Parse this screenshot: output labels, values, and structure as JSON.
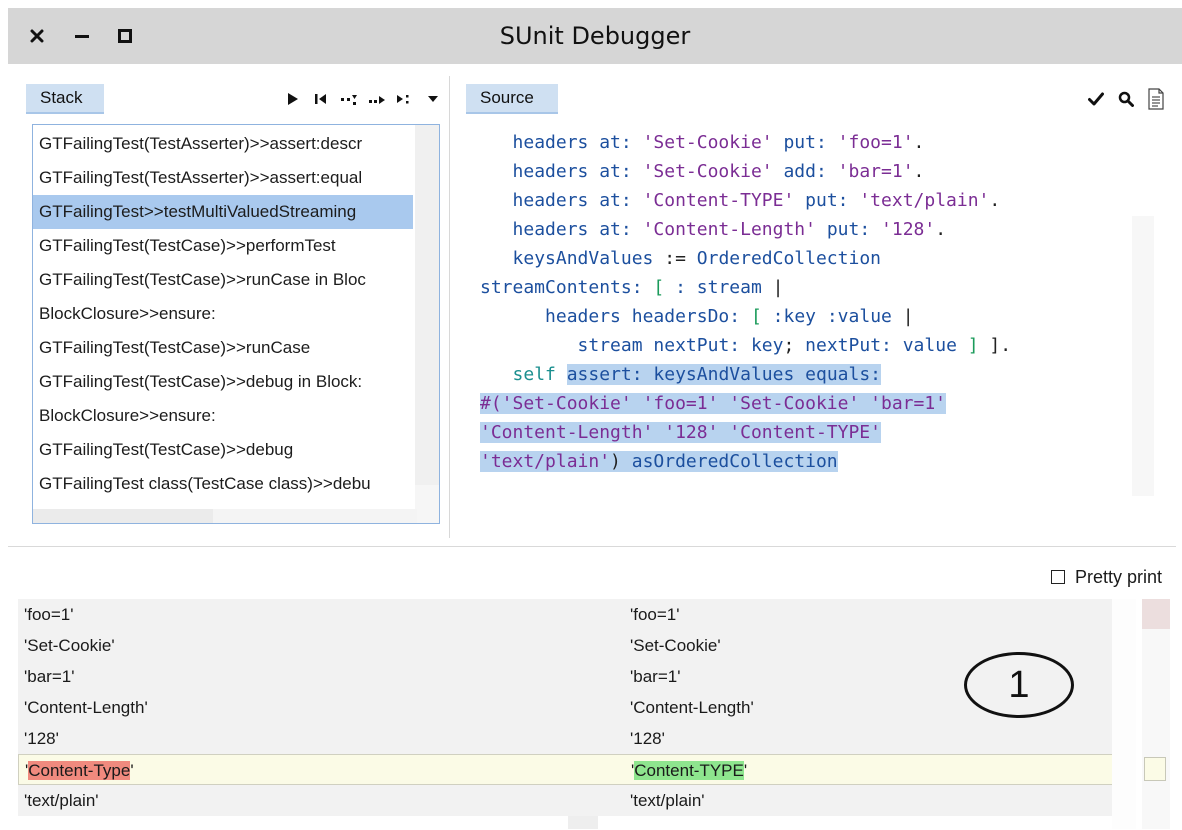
{
  "window": {
    "title": "SUnit Debugger",
    "controls": [
      "close",
      "minimize",
      "maximize"
    ]
  },
  "stack": {
    "tab_label": "Stack",
    "toolbar_icons": [
      "play-icon",
      "restart-icon",
      "step-into-icon",
      "step-over-icon",
      "step-through-icon",
      "dropdown-icon"
    ],
    "items": [
      "GTFailingTest(TestAsserter)>>assert:descr",
      "GTFailingTest(TestAsserter)>>assert:equal",
      "GTFailingTest>>testMultiValuedStreaming",
      "GTFailingTest(TestCase)>>performTest",
      "GTFailingTest(TestCase)>>runCase in Bloc",
      "BlockClosure>>ensure:",
      "GTFailingTest(TestCase)>>runCase",
      "GTFailingTest(TestCase)>>debug in Block:",
      "BlockClosure>>ensure:",
      "GTFailingTest(TestCase)>>debug",
      "GTFailingTest class(TestCase class)>>debu"
    ],
    "selected_index": 2
  },
  "source": {
    "tab_label": "Source",
    "toolbar_icons": [
      "accept-check-icon",
      "search-icon",
      "document-icon"
    ],
    "lines": [
      {
        "indent": "   ",
        "tokens": [
          [
            "k",
            "headers"
          ],
          [
            "plain",
            " "
          ],
          [
            "k",
            "at:"
          ],
          [
            "plain",
            " "
          ],
          [
            "str",
            "'Set-Cookie'"
          ],
          [
            "plain",
            " "
          ],
          [
            "k",
            "put:"
          ],
          [
            "plain",
            " "
          ],
          [
            "str",
            "'foo=1'"
          ],
          [
            "plain",
            "."
          ]
        ]
      },
      {
        "indent": "   ",
        "tokens": [
          [
            "k",
            "headers"
          ],
          [
            "plain",
            " "
          ],
          [
            "k",
            "at:"
          ],
          [
            "plain",
            " "
          ],
          [
            "str",
            "'Set-Cookie'"
          ],
          [
            "plain",
            " "
          ],
          [
            "k",
            "add:"
          ],
          [
            "plain",
            " "
          ],
          [
            "str",
            "'bar=1'"
          ],
          [
            "plain",
            "."
          ]
        ]
      },
      {
        "indent": "   ",
        "tokens": [
          [
            "k",
            "headers"
          ],
          [
            "plain",
            " "
          ],
          [
            "k",
            "at:"
          ],
          [
            "plain",
            " "
          ],
          [
            "str",
            "'Content-TYPE'"
          ],
          [
            "plain",
            " "
          ],
          [
            "k",
            "put:"
          ],
          [
            "plain",
            " "
          ],
          [
            "str",
            "'text/plain'"
          ],
          [
            "plain",
            "."
          ]
        ]
      },
      {
        "indent": "   ",
        "tokens": [
          [
            "k",
            "headers"
          ],
          [
            "plain",
            " "
          ],
          [
            "k",
            "at:"
          ],
          [
            "plain",
            " "
          ],
          [
            "str",
            "'Content-Length'"
          ],
          [
            "plain",
            " "
          ],
          [
            "k",
            "put:"
          ],
          [
            "plain",
            " "
          ],
          [
            "str",
            "'128'"
          ],
          [
            "plain",
            "."
          ]
        ]
      },
      {
        "indent": "   ",
        "tokens": [
          [
            "k",
            "keysAndValues"
          ],
          [
            "plain",
            " := "
          ],
          [
            "k",
            "OrderedCollection"
          ]
        ]
      },
      {
        "indent": "",
        "tokens": [
          [
            "k",
            "streamContents:"
          ],
          [
            "plain",
            " "
          ],
          [
            "br",
            "["
          ],
          [
            "plain",
            " "
          ],
          [
            "k",
            ": stream"
          ],
          [
            "plain",
            " |"
          ]
        ]
      },
      {
        "indent": "      ",
        "tokens": [
          [
            "k",
            "headers"
          ],
          [
            "plain",
            " "
          ],
          [
            "k",
            "headersDo:"
          ],
          [
            "plain",
            " "
          ],
          [
            "br",
            "["
          ],
          [
            "plain",
            " "
          ],
          [
            "k",
            ":key"
          ],
          [
            "plain",
            " "
          ],
          [
            "k",
            ":value"
          ],
          [
            "plain",
            " |"
          ]
        ]
      },
      {
        "indent": "         ",
        "tokens": [
          [
            "k",
            "stream"
          ],
          [
            "plain",
            " "
          ],
          [
            "k",
            "nextPut:"
          ],
          [
            "plain",
            " "
          ],
          [
            "k",
            "key"
          ],
          [
            "plain",
            "; "
          ],
          [
            "k",
            "nextPut:"
          ],
          [
            "plain",
            " "
          ],
          [
            "k",
            "value"
          ],
          [
            "plain",
            " "
          ],
          [
            "br",
            "]"
          ],
          [
            "plain",
            " ]."
          ]
        ]
      },
      {
        "indent": "   ",
        "tokens": [
          [
            "self",
            "self"
          ],
          [
            "plain",
            " "
          ],
          [
            "hlk",
            "assert:"
          ],
          [
            "hlp",
            " "
          ],
          [
            "hlk",
            "keysAndValues"
          ],
          [
            "hlp",
            " "
          ],
          [
            "hlk",
            "equals:"
          ]
        ]
      },
      {
        "indent": "",
        "tokens": [
          [
            "hlstr",
            "#('Set-Cookie'"
          ],
          [
            "hlp",
            " "
          ],
          [
            "hlstr",
            "'foo=1'"
          ],
          [
            "hlp",
            " "
          ],
          [
            "hlstr",
            "'Set-Cookie'"
          ],
          [
            "hlp",
            " "
          ],
          [
            "hlstr",
            "'bar=1'"
          ]
        ]
      },
      {
        "indent": "",
        "tokens": [
          [
            "hlstr",
            "'Content-Length'"
          ],
          [
            "hlp",
            " "
          ],
          [
            "hlstr",
            "'128'"
          ],
          [
            "hlp",
            " "
          ],
          [
            "hlstr",
            "'Content-TYPE'"
          ]
        ]
      },
      {
        "indent": "",
        "tokens": [
          [
            "hlstr",
            "'text/plain'"
          ],
          [
            "hlp",
            ") "
          ],
          [
            "hlk",
            "asOrderedCollection"
          ]
        ]
      }
    ]
  },
  "diff": {
    "pretty_print_label": "Pretty print",
    "pretty_print_checked": false,
    "rows": [
      {
        "left": "'foo=1'",
        "right": "'foo=1'"
      },
      {
        "left": "'Set-Cookie'",
        "right": "'Set-Cookie'"
      },
      {
        "left": "'bar=1'",
        "right": "'bar=1'"
      },
      {
        "left": "'Content-Length'",
        "right": "'Content-Length'"
      },
      {
        "left": "'128'",
        "right": "'128'"
      },
      {
        "left_quote": "'",
        "left_changed": "Content-Type",
        "left_tail": "'",
        "right_quote": "'",
        "right_changed": "Content-TYPE",
        "right_tail": "'",
        "changed": true
      },
      {
        "left": "'text/plain'",
        "right": "'text/plain'"
      }
    ],
    "callout": "1"
  },
  "colors": {
    "titlebar": "#d6d6d6",
    "tab": "#cfe0f2",
    "selection": "#a9c9ee",
    "code_highlight": "#b8d3ef",
    "removed": "#f08a7e",
    "added": "#8ee58e",
    "changed_row": "#fbfbe6"
  }
}
